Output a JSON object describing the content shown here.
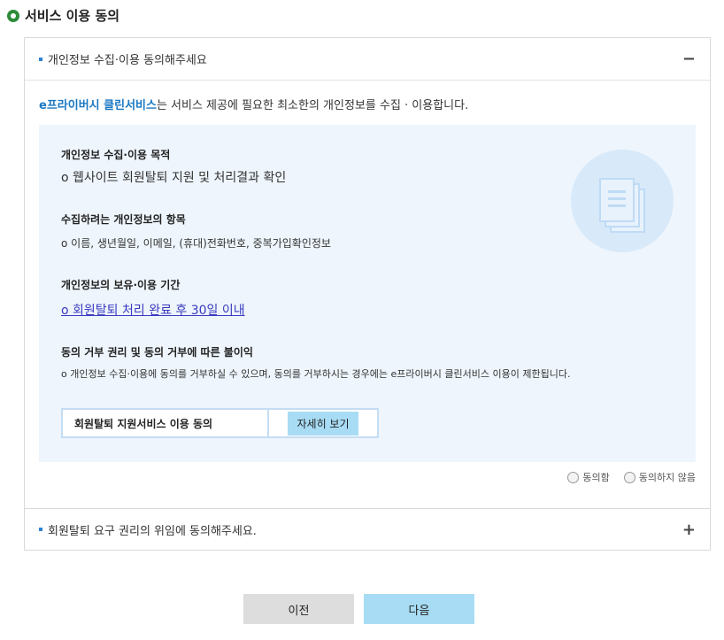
{
  "page": {
    "title": "서비스 이용 동의"
  },
  "section1": {
    "heading": "개인정보 수집·이용 동의해주세요",
    "toggle": "−",
    "intro_brand": "e프라이버시 클린서비스",
    "intro_rest": "는 서비스 제공에 필요한 최소한의 개인정보를 수집 · 이용합니다.",
    "items": [
      {
        "heading": "개인정보 수집·이용 목적",
        "value": "o 웹사이트 회원탈퇴 지원 및 처리결과 확인"
      },
      {
        "heading": "수집하려는 개인정보의 항목",
        "value": "o 이름, 생년월일, 이메일, (휴대)전화번호, 중복가입확인정보"
      },
      {
        "heading": "개인정보의 보유·이용 기간",
        "value": "o 회원탈퇴 처리 완료 후 30일 이내"
      },
      {
        "heading": "동의 거부 권리 및 동의 거부에 따른 불이익",
        "value": "o 개인정보 수집·이용에 동의를 거부하실 수 있으며, 동의를 거부하시는 경우에는 e프라이버시 클린서비스 이용이 제한됩니다."
      }
    ],
    "detail_label": "회원탈퇴 지원서비스 이용 동의",
    "detail_button": "자세히 보기",
    "agree": "동의함",
    "disagree": "동의하지 않음"
  },
  "section2": {
    "heading": "회원탈퇴 요구 권리의 위임에 동의해주세요.",
    "toggle": "+"
  },
  "footer": {
    "prev": "이전",
    "next": "다음"
  },
  "colors": {
    "accent": "#1a78c2",
    "next_button": "#a8dcf5",
    "prev_button": "#dddddd",
    "info_bg": "#eef5fc"
  }
}
